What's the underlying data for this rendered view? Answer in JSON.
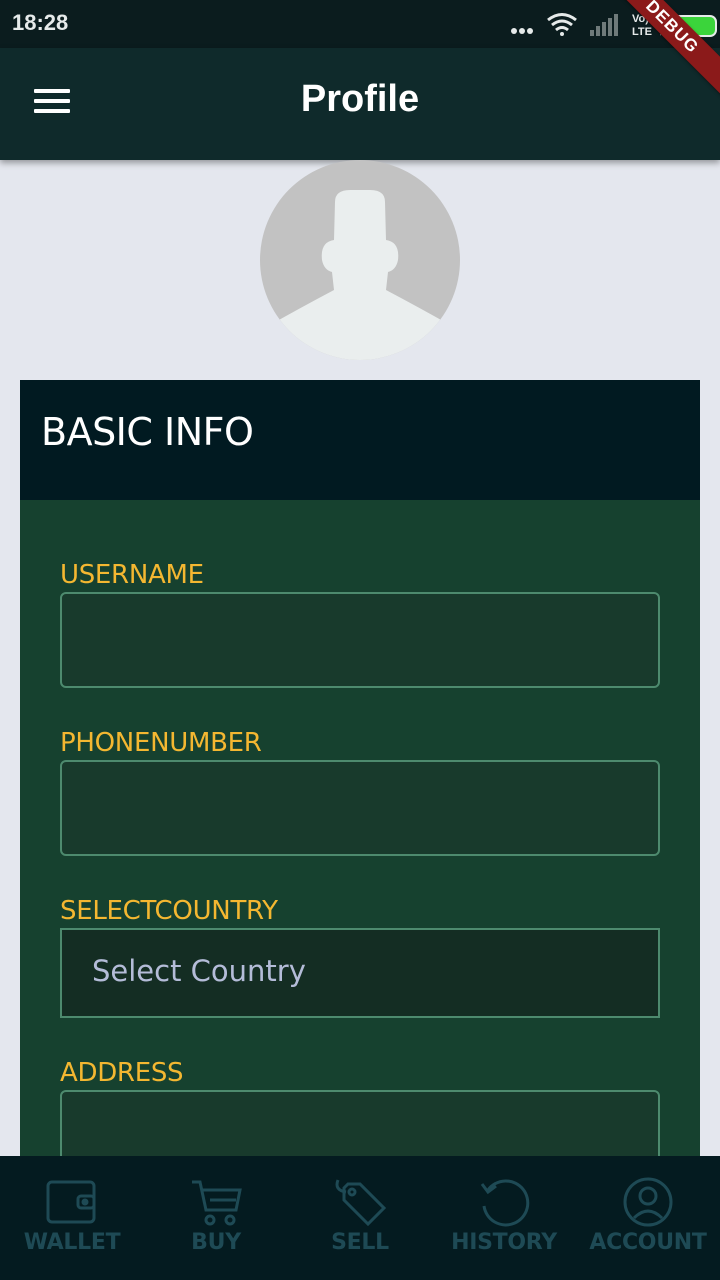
{
  "status_bar": {
    "time": "18:28",
    "icons": [
      "more-dots-icon",
      "wifi-icon",
      "signal-icon",
      "volte-icon",
      "battery-charging-icon"
    ],
    "volte_text": "Vo LTE"
  },
  "debug_banner": "DEBUG",
  "app_bar": {
    "title": "Profile",
    "menu_icon": "hamburger-menu-icon"
  },
  "profile": {
    "avatar_icon": "default-avatar-icon"
  },
  "basic_info": {
    "header": "BASIC INFO",
    "fields": {
      "username": {
        "label": "USERNAME",
        "value": ""
      },
      "phone": {
        "label": "PHONENUMBER",
        "value": ""
      },
      "country": {
        "label": "SELECTCOUNTRY",
        "selected": "Select Country"
      },
      "address": {
        "label": "ADDRESS",
        "value": ""
      }
    }
  },
  "bottom_nav": {
    "items": [
      {
        "label": "WALLET",
        "icon": "wallet-icon"
      },
      {
        "label": "BUY",
        "icon": "cart-icon"
      },
      {
        "label": "SELL",
        "icon": "tag-icon"
      },
      {
        "label": "HISTORY",
        "icon": "history-icon"
      },
      {
        "label": "ACCOUNT",
        "icon": "account-icon"
      }
    ]
  },
  "colors": {
    "app_bar": "#0f2a2b",
    "card_header": "#011a21",
    "card_body": "#16412f",
    "label": "#f4b731",
    "nav_inactive": "#1e4a55",
    "page_bg": "#e4e7ee"
  }
}
